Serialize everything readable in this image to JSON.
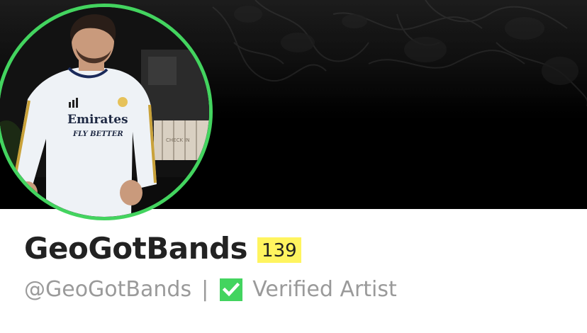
{
  "profile": {
    "display_name": "GeoGotBands",
    "iq": "139",
    "handle": "@GeoGotBands",
    "separator": "|",
    "verified_label": "Verified Artist",
    "avatar_ring_color": "#43d45f",
    "iq_badge_color": "#fff45f",
    "verified_icon_color": "#43d45f",
    "avatar_jersey_text": [
      "Emirates",
      "FLY BETTER"
    ],
    "avatar_background_sign": "CHECK IN"
  },
  "icons": {
    "verified": "check-box-icon"
  }
}
